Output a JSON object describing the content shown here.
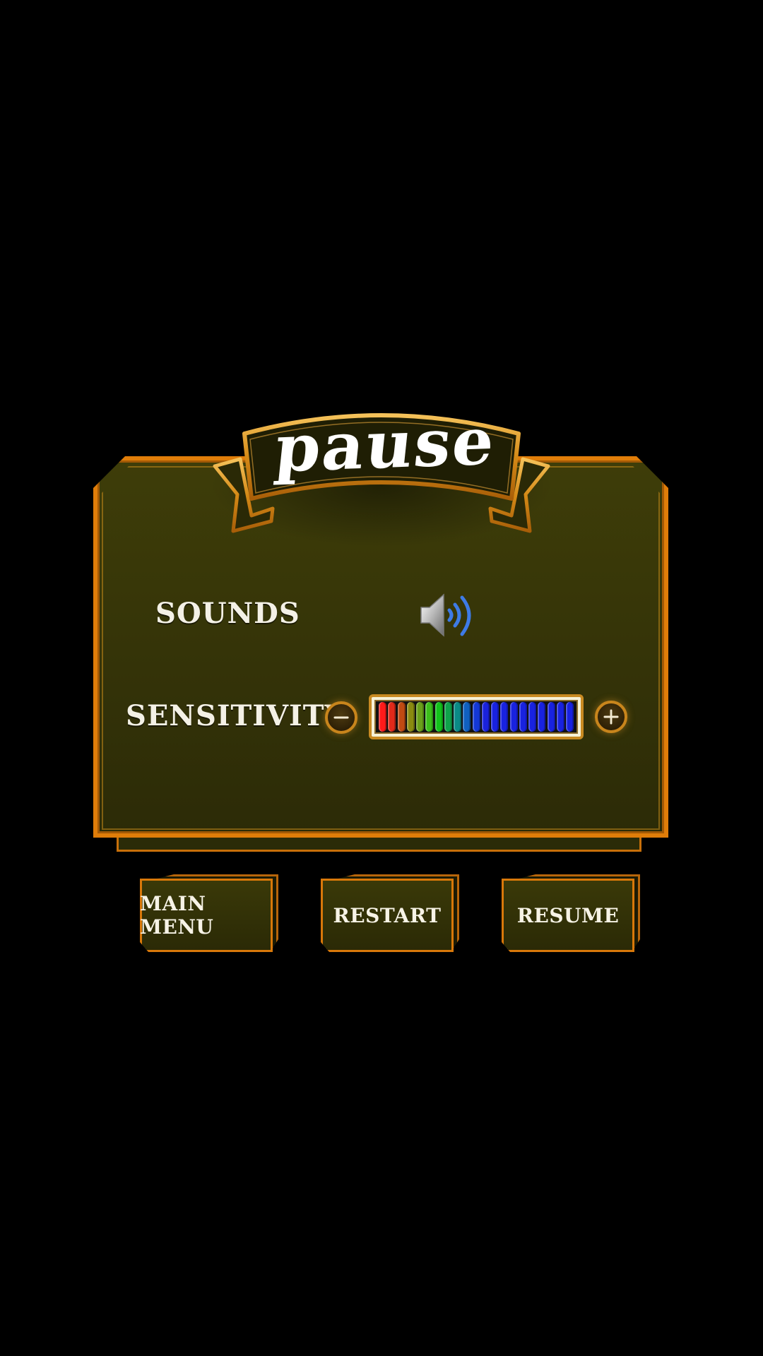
{
  "title": "pause",
  "settings": {
    "sounds_label": "SOUNDS",
    "sound_icon": "speaker-on-icon",
    "sensitivity_label": "SENSITIVITY",
    "sensitivity_level": 1.0,
    "minus_icon": "minus-icon",
    "plus_icon": "plus-icon"
  },
  "buttons": {
    "main_menu": "MAIN MENU",
    "restart": "RESTART",
    "resume": "RESUME"
  },
  "colors": {
    "accent": "#e07d09",
    "panel": "#3a3908",
    "meter_segments": [
      "#ff1a1a",
      "#e02a1a",
      "#c04a12",
      "#8a8a10",
      "#6aa01a",
      "#3cbe1a",
      "#12c21a",
      "#0fa24a",
      "#0a8a86",
      "#1060c0",
      "#1438d6",
      "#1a22dc",
      "#1822e0",
      "#1822e0",
      "#1822e0",
      "#1822e0",
      "#1822e0",
      "#1822e0",
      "#1822e0",
      "#1822e0",
      "#1822e0"
    ]
  }
}
